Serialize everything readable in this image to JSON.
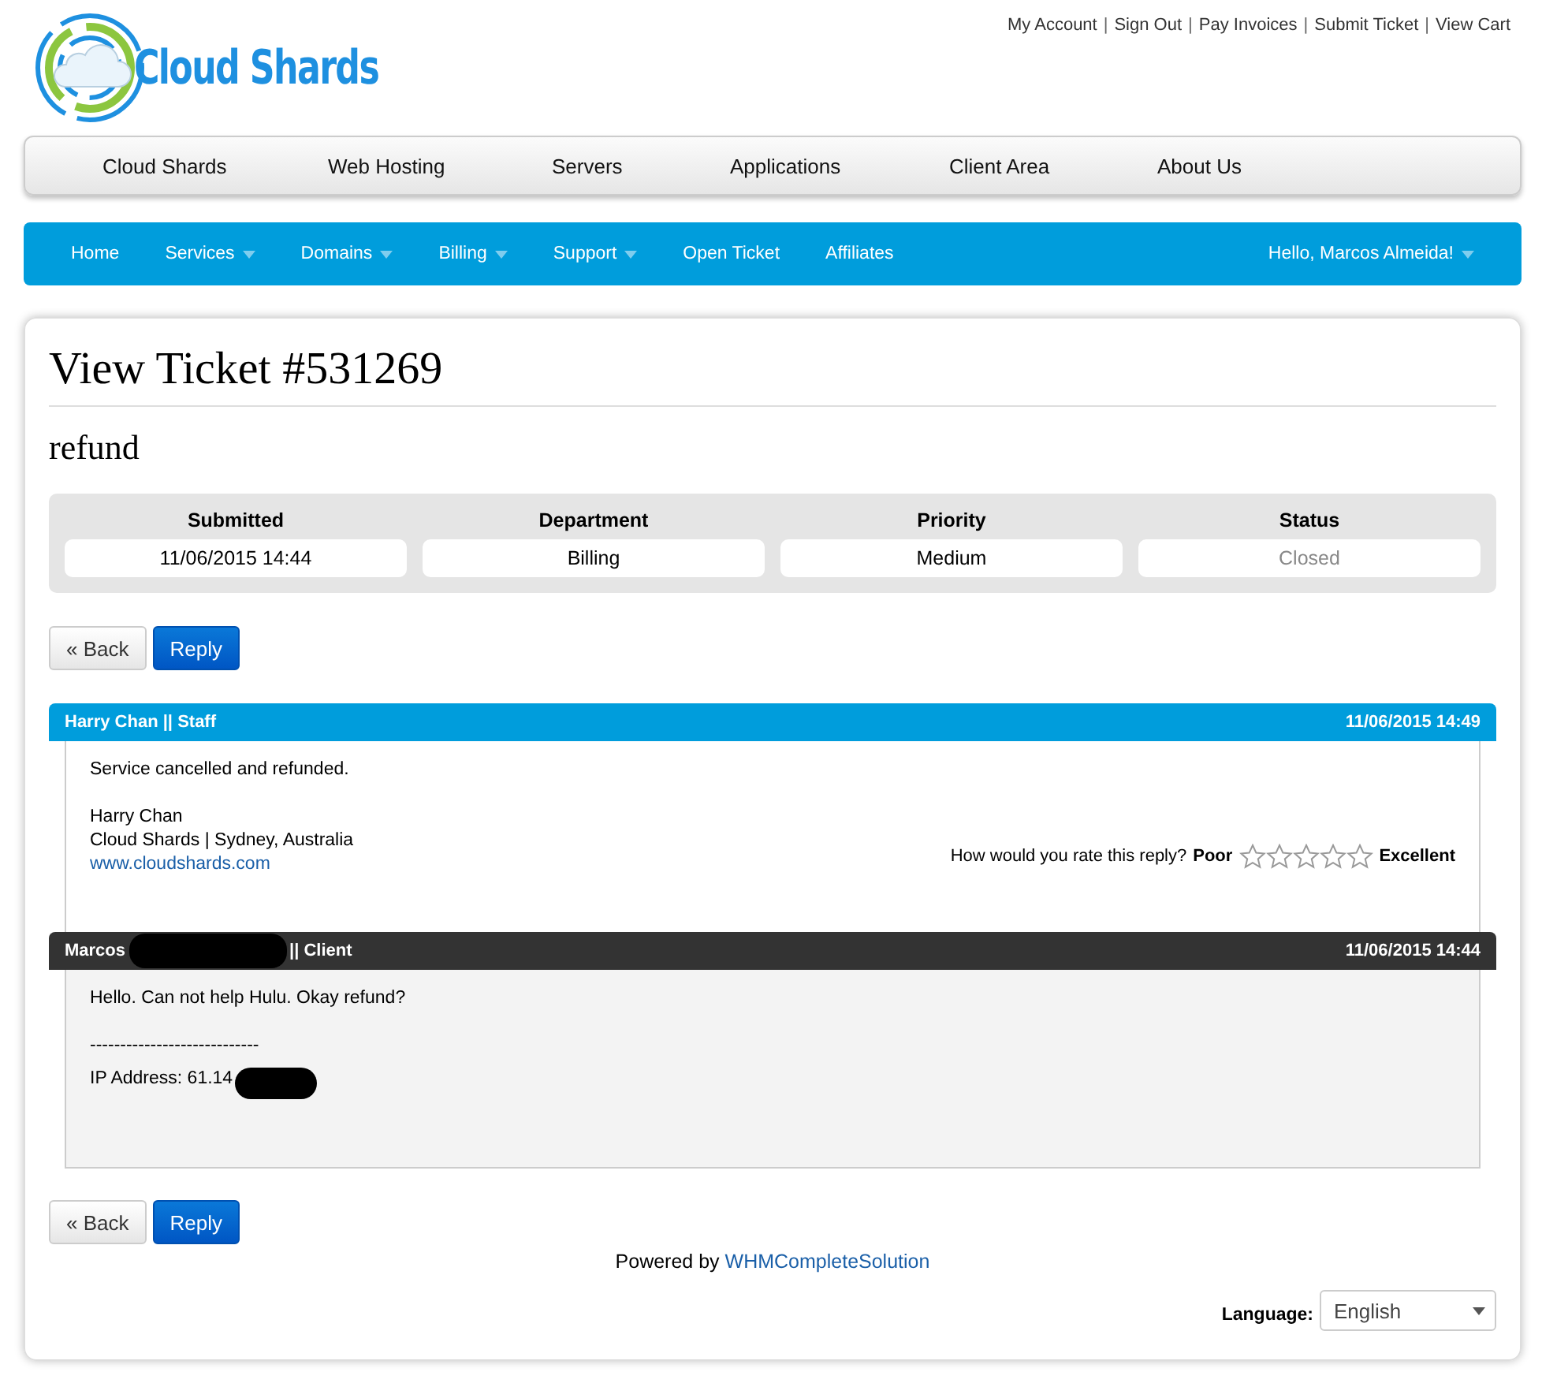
{
  "logo": {
    "text": "Cloud Shards"
  },
  "top_links": [
    {
      "kind": "link",
      "text": "My Account"
    },
    {
      "kind": "separator",
      "text": "|"
    },
    {
      "kind": "link",
      "text": "Sign Out"
    },
    {
      "kind": "separator",
      "text": "|"
    },
    {
      "kind": "link",
      "text": "Pay Invoices"
    },
    {
      "kind": "separator",
      "text": "|"
    },
    {
      "kind": "link",
      "text": "Submit Ticket"
    },
    {
      "kind": "separator",
      "text": "|"
    },
    {
      "kind": "link",
      "text": "View Cart"
    }
  ],
  "main_menu": [
    "Cloud Shards",
    "Web Hosting",
    "Servers",
    "Applications",
    "Client Area",
    "About Us"
  ],
  "nav": {
    "items": [
      {
        "label": "Home",
        "has_menu": false
      },
      {
        "label": "Services",
        "has_menu": true
      },
      {
        "label": "Domains",
        "has_menu": true
      },
      {
        "label": "Billing",
        "has_menu": true
      },
      {
        "label": "Support",
        "has_menu": true
      },
      {
        "label": "Open Ticket",
        "has_menu": false
      },
      {
        "label": "Affiliates",
        "has_menu": false
      }
    ],
    "user": {
      "label": "Hello, Marcos Almeida!",
      "has_menu": true
    }
  },
  "ticket": {
    "title": "View Ticket #531269",
    "subject": "refund",
    "info": [
      {
        "label": "Submitted",
        "value": "11/06/2015 14:44",
        "muted": false
      },
      {
        "label": "Department",
        "value": "Billing",
        "muted": false
      },
      {
        "label": "Priority",
        "value": "Medium",
        "muted": false
      },
      {
        "label": "Status",
        "value": "Closed",
        "muted": true
      }
    ]
  },
  "buttons_top": [
    {
      "label": "« Back",
      "kind": "default"
    },
    {
      "label": "Reply",
      "kind": "primary"
    }
  ],
  "messages": [
    {
      "kind": "staff",
      "author": "Harry Chan || Staff",
      "author_redacted": false,
      "date": "11/06/2015 14:49",
      "paragraphs": [
        [
          "Service cancelled and refunded."
        ],
        [
          "Harry Chan",
          "Cloud Shards | Sydney, Australia"
        ]
      ],
      "link": "www.cloudshards.com",
      "redacted": false,
      "rating": {
        "question": "How would you rate this reply?",
        "low": "Poor",
        "high": "Excellent",
        "stars": 0
      }
    },
    {
      "kind": "client",
      "author": "Marcos",
      "author_redacted": true,
      "author_suffix": "|| Client",
      "date": "11/06/2015 14:44",
      "paragraphs": [
        [
          "Hello. Can not help Hulu. Okay refund?"
        ],
        [
          "----------------------------",
          "IP Address: 61.14"
        ]
      ],
      "redacted": true
    }
  ],
  "buttons_bottom": [
    {
      "label": "« Back",
      "kind": "default"
    },
    {
      "label": "Reply",
      "kind": "primary"
    }
  ],
  "footer": {
    "powered_by": "Powered by",
    "powered_link": "WHMCompleteSolution",
    "language_label": "Language:",
    "language_value": "English"
  }
}
